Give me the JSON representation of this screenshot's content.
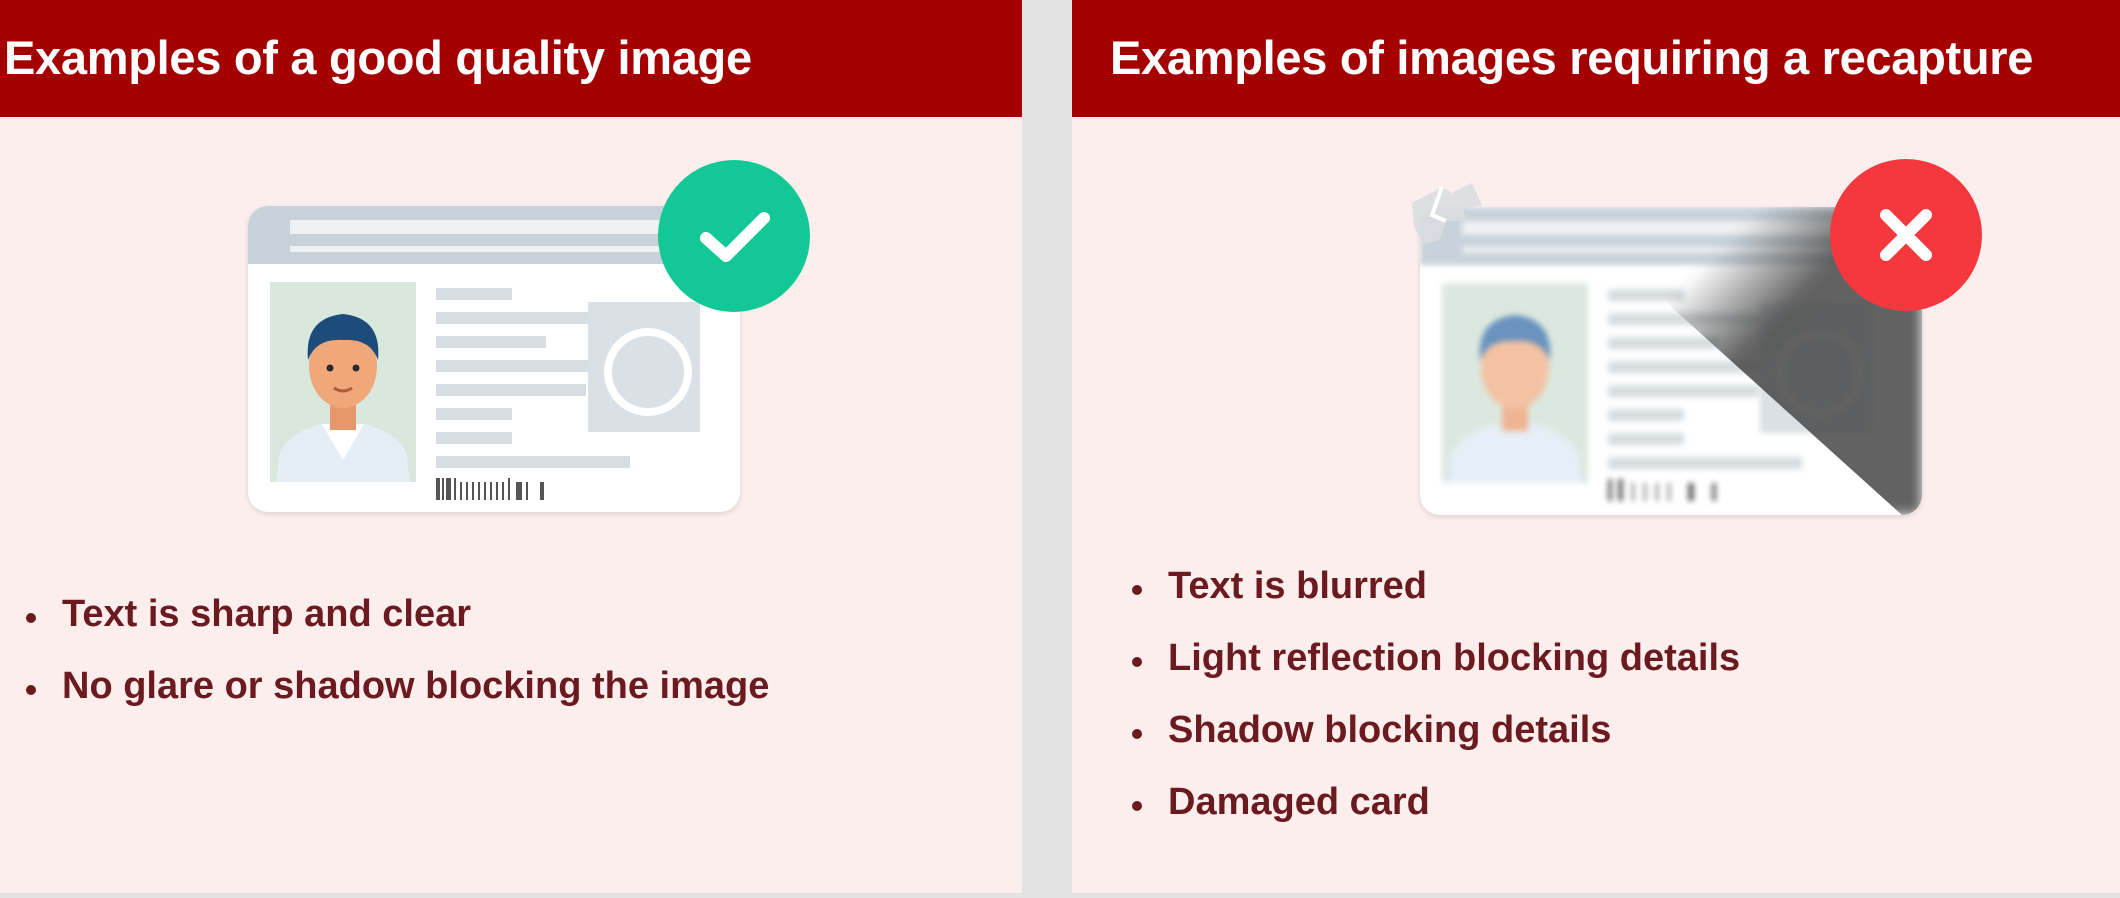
{
  "good": {
    "title": "Examples of a good quality image",
    "badge_icon": "check-icon",
    "points": [
      "Text is sharp and clear",
      "No glare or shadow blocking the image"
    ]
  },
  "bad": {
    "title": "Examples of images requiring a recapture",
    "badge_icon": "cross-icon",
    "points": [
      "Text is blurred",
      "Light reflection blocking details",
      "Shadow blocking details",
      "Damaged card"
    ]
  },
  "colors": {
    "header_bg": "#a50000",
    "panel_bg": "#fdeeee",
    "text": "#6b1a1f",
    "good_badge": "#13c896",
    "bad_badge": "#f5383d"
  }
}
